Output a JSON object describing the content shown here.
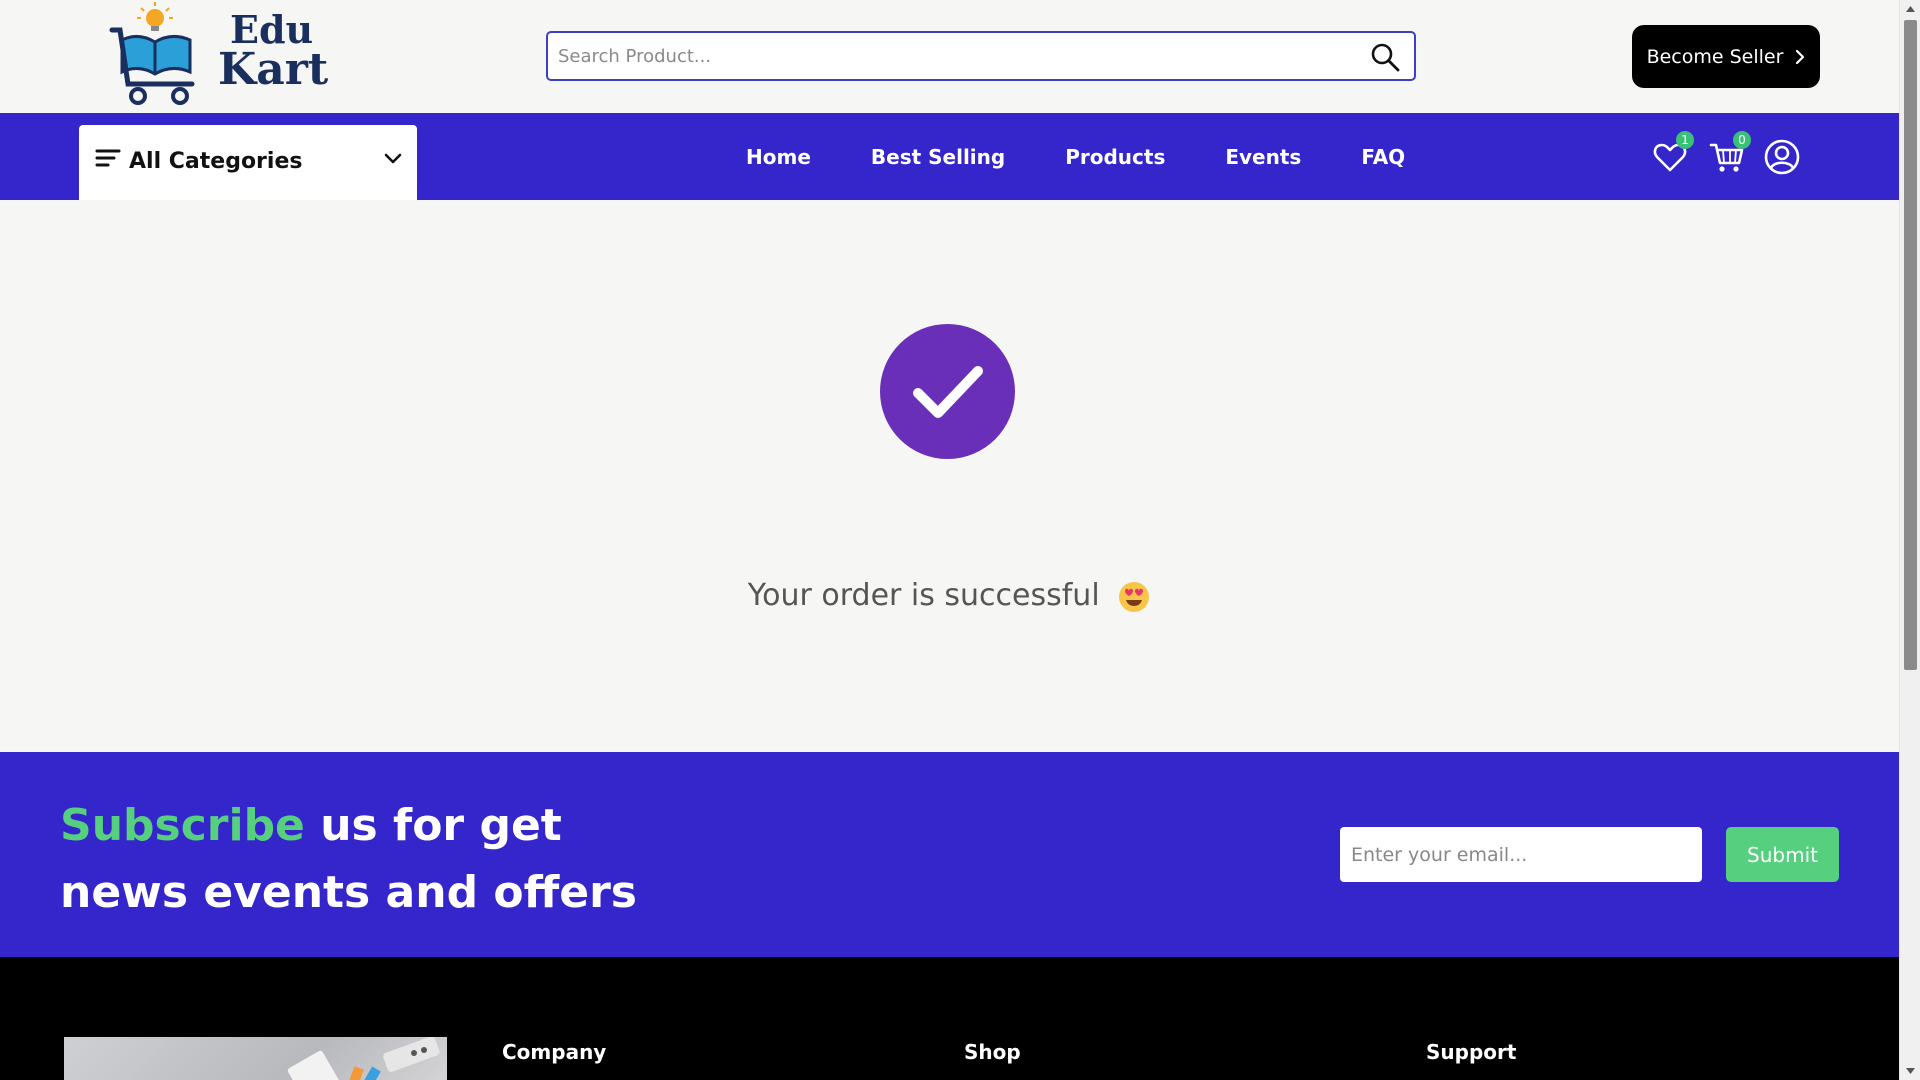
{
  "header": {
    "logo_line1": "Edu",
    "logo_line2": "Kart",
    "search_placeholder": "Search Product...",
    "become_seller_label": "Become Seller"
  },
  "nav": {
    "categories_label": "All Categories",
    "links": [
      "Home",
      "Best Selling",
      "Products",
      "Events",
      "FAQ"
    ],
    "wishlist_count": "1",
    "cart_count": "0"
  },
  "main": {
    "success_message": "Your order is successful"
  },
  "subscribe": {
    "title_accent": "Subscribe",
    "title_rest": " us for get news events and offers",
    "email_placeholder": "Enter your email...",
    "submit_label": "Submit"
  },
  "footer": {
    "headings": [
      "Company",
      "Shop",
      "Support"
    ]
  },
  "colors": {
    "brand_blue": "#3526cb",
    "accent_green": "#56d07f",
    "success_purple": "#6a2fb8"
  }
}
